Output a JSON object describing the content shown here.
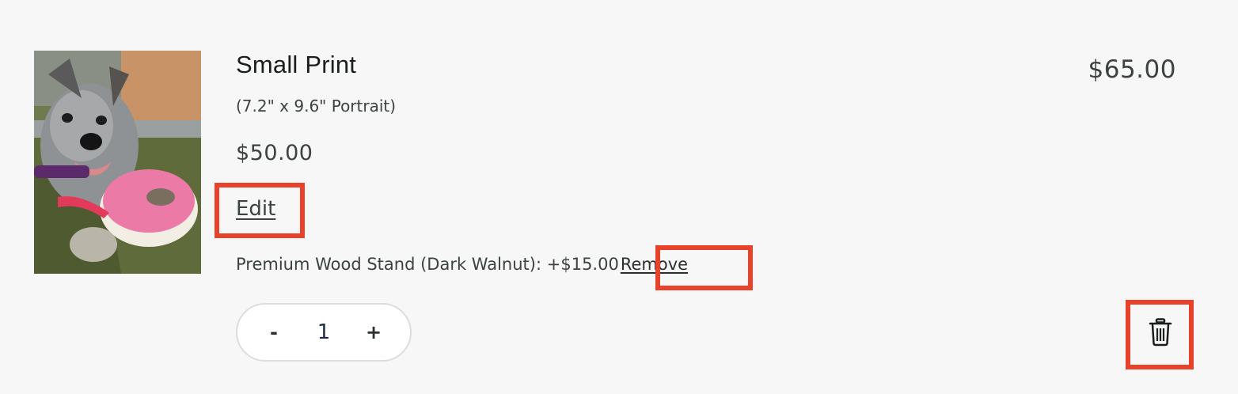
{
  "item": {
    "title": "Small Print",
    "size": "(7.2\" x 9.6\" Portrait)",
    "unit_price": "$50.00",
    "edit_label": "Edit",
    "addon": {
      "label": "Premium Wood Stand (Dark Walnut):",
      "price": "+$15.00",
      "remove_label": "Remove"
    },
    "quantity": {
      "decrement_label": "-",
      "value": "1",
      "increment_label": "+"
    },
    "total": "$65.00",
    "thumbnail_icon": "product-photo-puppy-with-donut-toy"
  },
  "colors": {
    "background": "#f6f7f6",
    "highlight": "#e8432a",
    "text": "#3b4241"
  }
}
